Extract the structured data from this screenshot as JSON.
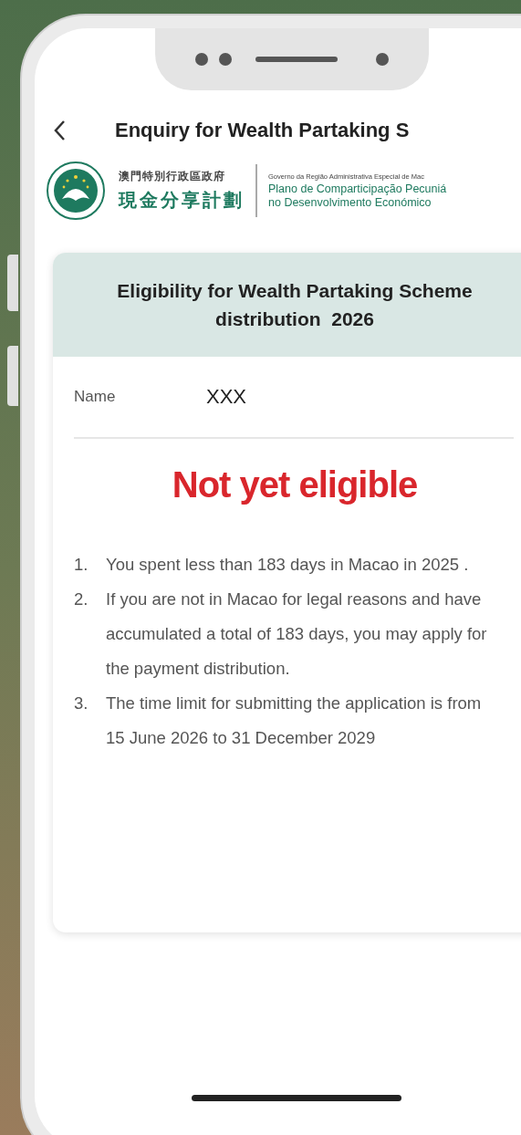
{
  "header": {
    "title": "Enquiry for Wealth Partaking S"
  },
  "banner": {
    "chinese_lines": [
      "澳門特別行政區政府",
      "現金分享計劃"
    ],
    "portuguese_lines": [
      "Governo da Região Administrativa Especial de Mac",
      "Plano de Comparticipação Pecuniá",
      "no Desenvolvimento Económico"
    ]
  },
  "card": {
    "title": "Eligibility for Wealth Partaking Scheme distribution  2026",
    "name_label": "Name",
    "name_value": "XXX",
    "status": "Not yet eligible",
    "notes": [
      {
        "number": "1.",
        "text": "You spent less than 183 days in Macao in 2025 ."
      },
      {
        "number": "2.",
        "text": "If you are not in Macao for legal reasons and have accumulated a total of 183 days, you may apply for the payment distribution."
      },
      {
        "number": "3.",
        "text": "The time limit for submitting the application is from 15 June 2026  to 31 December  2029"
      }
    ]
  }
}
